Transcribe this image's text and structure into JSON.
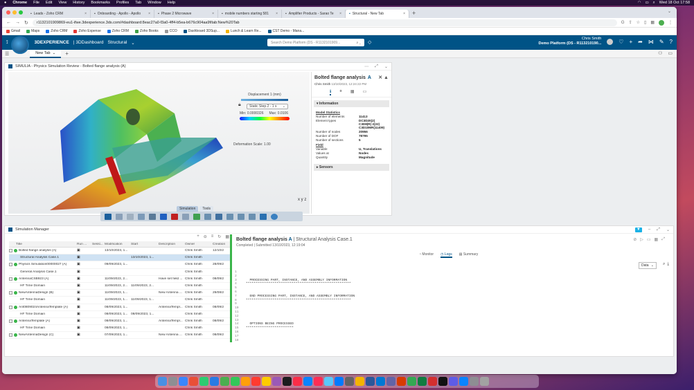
{
  "menubar": {
    "items": [
      "Chrome",
      "File",
      "Edit",
      "View",
      "History",
      "Bookmarks",
      "Profiles",
      "Tab",
      "Window",
      "Help"
    ],
    "clock": "Wed 18 Oct 17:58"
  },
  "browser": {
    "tabs": [
      {
        "label": "Leads - Zoho CRM",
        "active": false
      },
      {
        "label": "Onboarding - Apollo - Apollo",
        "active": false
      },
      {
        "label": "Phase 2 Microwave",
        "active": false
      },
      {
        "label": "mobile numbers starting 581",
        "active": false
      },
      {
        "label": "Amplifier Products - Sarao Te",
        "active": false
      },
      {
        "label": "Structural - New Tab",
        "active": true
      }
    ],
    "url": "r1132101909869-eu1-ifwe.3dexperience.3ds.com/#dashboard:8eac27a0-f3a0-4ff4-b5ea-b676c904aa9f/tab:New%20Tab",
    "bookmarks": [
      "Gmail",
      "Maps",
      "Zoho CRM",
      "Zoho Expense",
      "Zoho CRM",
      "Zoho Books",
      "CCO",
      "Dashboard 3DSup...",
      "Lunch & Learn Re...",
      "CST Demo - Mana..."
    ]
  },
  "ds": {
    "brand_a": "3DEXPERIENCE",
    "brand_b": "| 3DDashboard",
    "brand_c": "Structural",
    "search_placeholder": "Search Demo Platform (DS - R1132101909...",
    "user_name": "Chris Smith",
    "platform": "Demo Platform (DS - R113210190...",
    "tab_label": "New Tab"
  },
  "physics": {
    "title": "SIMULIA - Physics Simulation Review - Bolted flange analysis (A)",
    "legend_title": "Displacement 1 (mm)",
    "step": "Static Step.2 - 1 s",
    "min": "Min: 0.0000326",
    "max": "Max: 0.0106",
    "deformation": "Deformation Scale: 1.00",
    "toolbar_tabs": [
      "Simulation",
      "Tools"
    ],
    "axes_label": "x y z",
    "panel": {
      "title": "Bolted flange analysis",
      "rev": "A",
      "author": "Chris Smith",
      "date": "13/10/2023, 12:24:22 PM",
      "section": "Information",
      "sensors": "Sensors",
      "stats_header": "Model Statistics",
      "stats": [
        {
          "k": "Number of elements",
          "v": "11413"
        },
        {
          "k": "Element types",
          "v": "DC3D20(2) C3D8(R) 2(22) C3D10MR(11409)"
        },
        {
          "k": "Number of nodes",
          "v": "20956"
        },
        {
          "k": "Number of DOF",
          "v": "78795"
        },
        {
          "k": "Number of sections",
          "v": "5"
        }
      ],
      "field_header": "Field",
      "field": [
        {
          "k": "Variable",
          "v": "U, Translations"
        },
        {
          "k": "Values at",
          "v": "Nodes"
        },
        {
          "k": "Quantity",
          "v": "Magnitude"
        }
      ]
    }
  },
  "manager": {
    "title": "Simulation Manager",
    "columns": [
      "Title",
      "Run ...",
      "Sessi...",
      "Modification",
      "Start",
      "Description",
      "Owner",
      "Creation"
    ],
    "rows": [
      {
        "title": "Bolted flange analysis (A)",
        "mod": "13/10/2023, 1...",
        "start": "",
        "desc": "",
        "owner": "Chris Smith",
        "cre": "12/10/2",
        "lvl": 0
      },
      {
        "title": "Structural Analysis Case.1",
        "mod": "",
        "start": "13/10/2023, 1...",
        "desc": "",
        "owner": "Chris Smith",
        "cre": "",
        "lvl": 1
      },
      {
        "title": "Physics Simulation00000027 (A)",
        "mod": "09/09/2023, 1...",
        "start": "",
        "desc": "",
        "owner": "Chris Smith",
        "cre": "28/09/2",
        "lvl": 0
      },
      {
        "title": "General Analysis Case.1",
        "mod": "",
        "start": "",
        "desc": "",
        "owner": "Chris Smith",
        "cre": "",
        "lvl": 1
      },
      {
        "title": "AntennaCSB923 (A)",
        "mod": "11/09/2023, 2...",
        "start": "",
        "desc": "Have set field ...",
        "owner": "Chris Smith",
        "cre": "08/09/2",
        "lvl": 0
      },
      {
        "title": "HF Time Domain",
        "mod": "11/09/2023, 2...",
        "start": "11/09/2023, 2...",
        "desc": "",
        "owner": "Chris Smith",
        "cre": "",
        "lvl": 1
      },
      {
        "title": "NewAntennaDesign (B)",
        "mod": "11/09/2023, 1...",
        "start": "",
        "desc": "New Antenna ...",
        "owner": "Chris Smith",
        "cre": "29/08/2",
        "lvl": 0
      },
      {
        "title": "HF Time Domain",
        "mod": "11/09/2023, 1...",
        "start": "11/09/2023, 1...",
        "desc": "",
        "owner": "Chris Smith",
        "cre": "",
        "lvl": 1
      },
      {
        "title": "Ant0809024AntennaTemplate (A)",
        "mod": "08/09/2023, 1...",
        "start": "",
        "desc": "AntennaTempl...",
        "owner": "Chris Smith",
        "cre": "08/09/2",
        "lvl": 0
      },
      {
        "title": "HF Time Domain",
        "mod": "08/09/2023, 1...",
        "start": "08/09/2023, 1...",
        "desc": "",
        "owner": "Chris Smith",
        "cre": "",
        "lvl": 1
      },
      {
        "title": "AntennaTemplate (A)",
        "mod": "08/09/2023, 1...",
        "start": "",
        "desc": "AntennaTempl...",
        "owner": "Chris Smith",
        "cre": "08/09/2",
        "lvl": 0
      },
      {
        "title": "HF Time Domain",
        "mod": "08/09/2023, 1...",
        "start": "",
        "desc": "",
        "owner": "Chris Smith",
        "cre": "",
        "lvl": 1
      },
      {
        "title": "NewAntennaDesign (C)",
        "mod": "07/09/2023, 1...",
        "start": "",
        "desc": "New Antenna ...",
        "owner": "Chris Smith",
        "cre": "08/09/2",
        "lvl": 0
      }
    ],
    "detail": {
      "title": "Bolted flange analysis",
      "rev": "A",
      "case": "| Structural Analysis Case.1",
      "status": "Completed | Submitted 13/10/2023, 12:19:04",
      "tabs": [
        "Monitor",
        "Logs",
        "Summary"
      ],
      "data_select": "Data",
      "log_lines": [
        "",
        "",
        "  PROCESSING PART, INSTANCE, AND ASSEMBLY INFORMATION",
        "*******************************************************",
        "",
        "",
        "  END PROCESSING PART, INSTANCE, AND ASSEMBLY INFORMATION",
        "*******************************************************",
        "",
        "",
        "",
        "",
        "",
        "  OPTIONS BEING PROCESSED",
        "*************************",
        "",
        "",
        ""
      ]
    }
  }
}
